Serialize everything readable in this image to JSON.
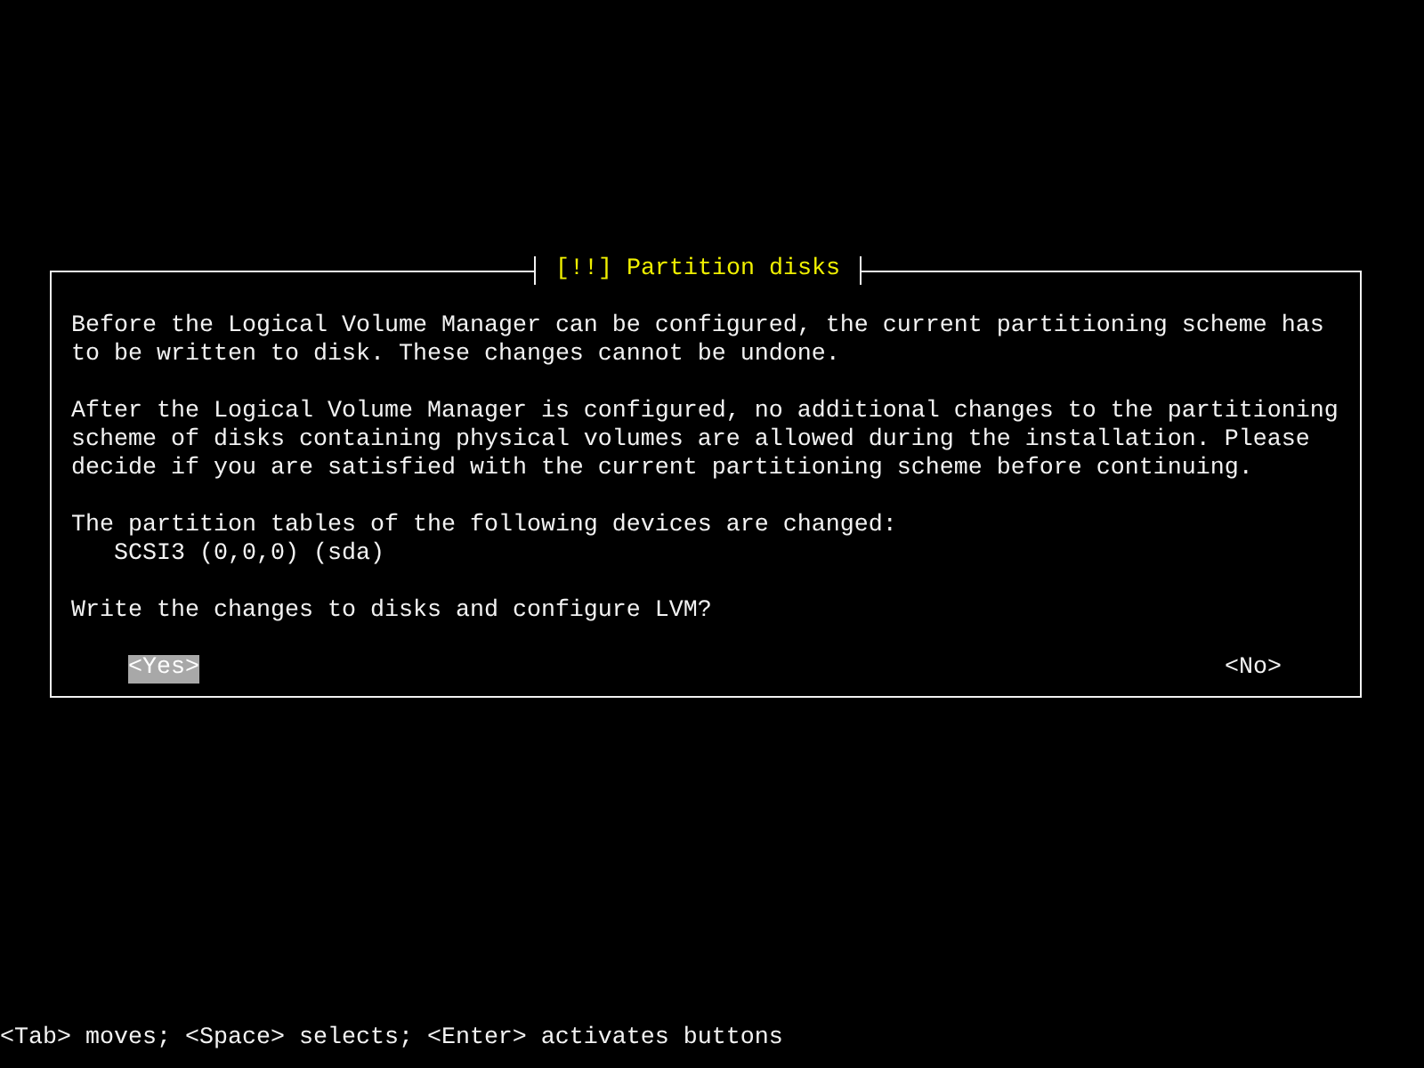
{
  "dialog": {
    "title": "[!!] Partition disks",
    "paragraphs": [
      "Before the Logical Volume Manager can be configured, the current partitioning scheme has to be written to disk. These changes cannot be undone.",
      "After the Logical Volume Manager is configured, no additional changes to the partitioning scheme of disks containing physical volumes are allowed during the installation. Please decide if you are satisfied with the current partitioning scheme before continuing."
    ],
    "changed_devices": {
      "heading": "The partition tables of the following devices are changed:",
      "devices": [
        "SCSI3 (0,0,0) (sda)"
      ]
    },
    "question": "Write the changes to disks and configure LVM?",
    "buttons": [
      {
        "label": "<Yes>",
        "selected": true
      },
      {
        "label": "<No>",
        "selected": false
      }
    ]
  },
  "help_line": "<Tab> moves; <Space> selects; <Enter> activates buttons"
}
